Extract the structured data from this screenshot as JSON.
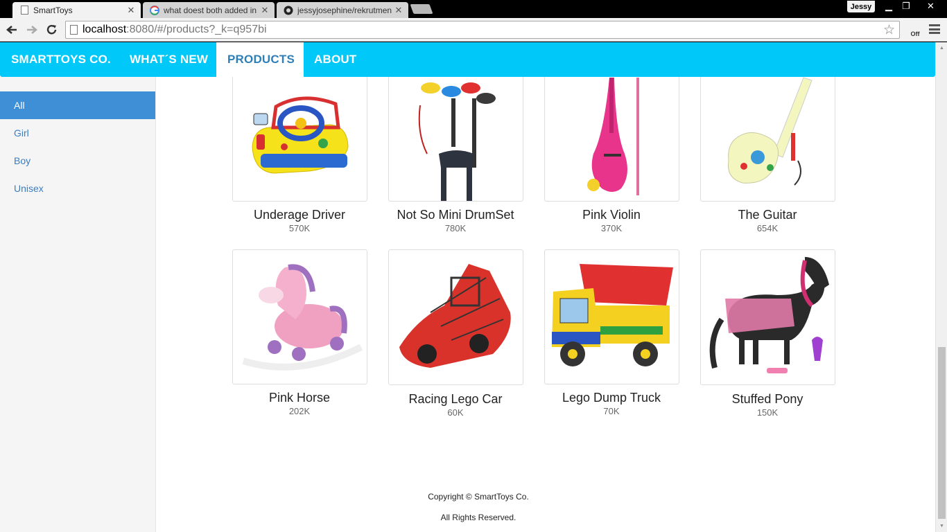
{
  "browser": {
    "tabs": [
      {
        "title": "SmartToys",
        "active": true
      },
      {
        "title": "what doest both added in",
        "active": false
      },
      {
        "title": "jessyjosephine/rekrutmen",
        "active": false
      }
    ],
    "profile_name": "Jessy",
    "url_host": "localhost",
    "url_rest": ":8080/#/products?_k=q957bi",
    "extension_badge": "Off"
  },
  "nav": {
    "brand": "SMARTTOYS CO.",
    "whats_new": "WHAT´S NEW",
    "products": "PRODUCTS",
    "about": "ABOUT"
  },
  "sidebar": {
    "items": [
      {
        "label": "All",
        "active": true
      },
      {
        "label": "Girl",
        "active": false
      },
      {
        "label": "Boy",
        "active": false
      },
      {
        "label": "Unisex",
        "active": false
      }
    ]
  },
  "products": [
    {
      "name": "Underage Driver",
      "price": "570K"
    },
    {
      "name": "Not So Mini DrumSet",
      "price": "780K"
    },
    {
      "name": "Pink Violin",
      "price": "370K"
    },
    {
      "name": "The Guitar",
      "price": "654K"
    },
    {
      "name": "Pink Horse",
      "price": "202K"
    },
    {
      "name": "Racing Lego Car",
      "price": "60K"
    },
    {
      "name": "Lego Dump Truck",
      "price": "70K"
    },
    {
      "name": "Stuffed Pony",
      "price": "150K"
    }
  ],
  "footer": {
    "copyright": "Copyright © SmartToys Co.",
    "rights": "All Rights Reserved."
  }
}
